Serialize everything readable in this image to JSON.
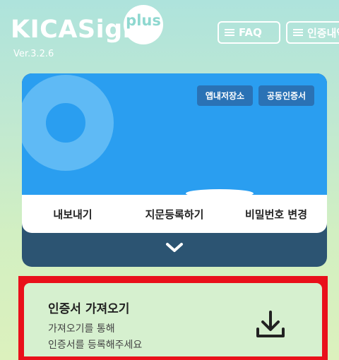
{
  "header": {
    "logo": "KICASign",
    "logo_badge": "plus",
    "version": "Ver.3.2.6",
    "faq_label": "FAQ",
    "history_label": "인증내역"
  },
  "card": {
    "chips": {
      "app_storage": "앱내저장소",
      "common_cert": "공동인증서"
    },
    "actions": {
      "export": "내보내기",
      "fingerprint": "지문등록하기",
      "change_password": "비밀번호 변경"
    },
    "expand_icon": "chevron-down-icon"
  },
  "import": {
    "title": "인증서 가져오기",
    "desc_line1": "가져오기를 통해",
    "desc_line2": "인증서를 등록해주세요",
    "icon": "download-icon"
  },
  "colors": {
    "card_blue": "#2a9ef0",
    "card_footer": "#2c5472",
    "chip": "#2a72b5",
    "highlight_border": "#e9101a"
  }
}
